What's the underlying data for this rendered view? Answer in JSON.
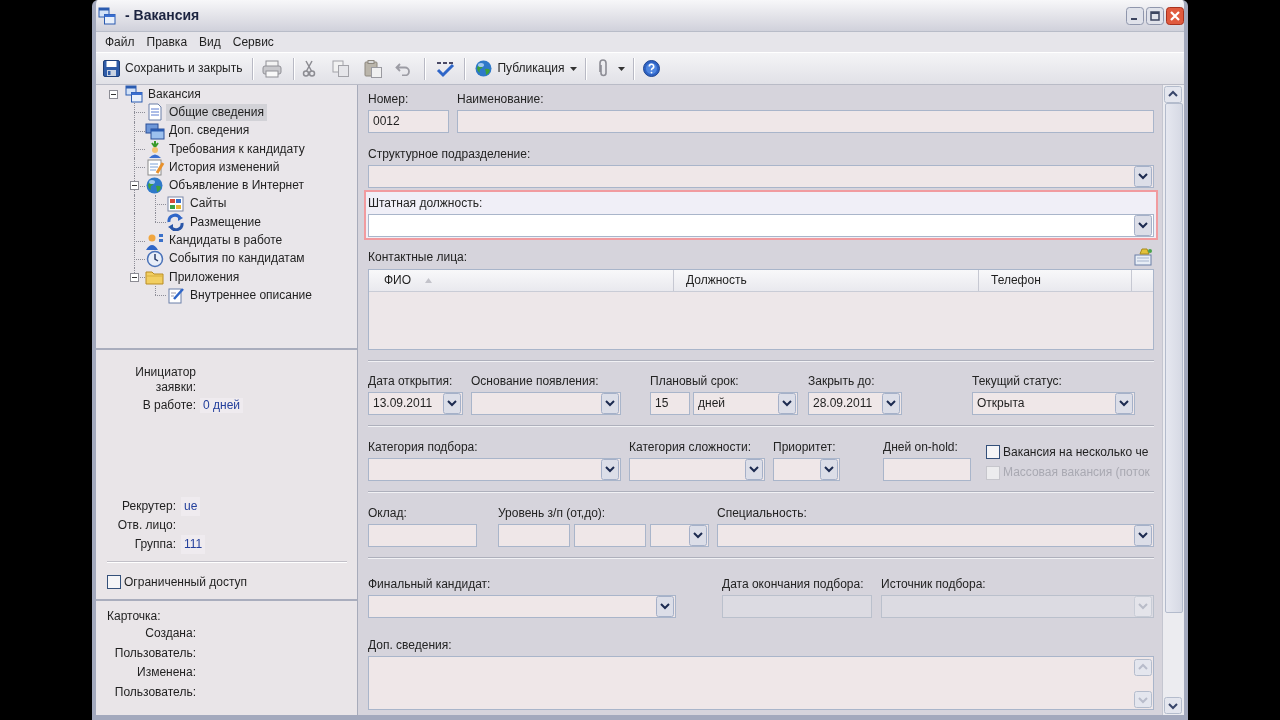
{
  "window": {
    "title": "- Вакансия"
  },
  "menu": [
    {
      "label": "Файл"
    },
    {
      "label": "Правка"
    },
    {
      "label": "Вид"
    },
    {
      "label": "Сервис"
    }
  ],
  "toolbar": {
    "save_button": {
      "label": "Сохранить и закрыть"
    },
    "print_button": {
      "disabled": true
    },
    "cut_button": {
      "disabled": true
    },
    "copy_button": {
      "disabled": true
    },
    "paste_button": {
      "disabled": true
    },
    "undo_button": {
      "disabled": true
    },
    "publish_button": {
      "label": "Публикация"
    }
  },
  "tree": [
    {
      "label": "Вакансия",
      "selected": false,
      "expanded": true,
      "children": [
        {
          "label": "Общие сведения",
          "selected": true
        },
        {
          "label": "Доп. сведения",
          "selected": false
        },
        {
          "label": "Требования к кандидату",
          "selected": false
        },
        {
          "label": "История изменений",
          "selected": false
        },
        {
          "label": "Объявление в Интернет",
          "selected": false,
          "expanded": true,
          "children": [
            {
              "label": "Сайты",
              "selected": false
            },
            {
              "label": "Размещение",
              "selected": false
            }
          ]
        },
        {
          "label": "Кандидаты в работе",
          "selected": false
        },
        {
          "label": "События по кандидатам",
          "selected": false
        },
        {
          "label": "Приложения",
          "selected": false,
          "expanded": true,
          "children": [
            {
              "label": "Внутреннее описание",
              "selected": false
            }
          ]
        }
      ]
    }
  ],
  "request_info": [
    {
      "label": "Инициатор заявки:"
    },
    {
      "label": "В работе:",
      "value": "0 дней"
    }
  ],
  "staff_info": [
    {
      "label": "Рекрутер:",
      "value": "ue"
    },
    {
      "label": "Отв. лицо:"
    },
    {
      "label": "Группа:",
      "value": "111"
    }
  ],
  "restricted_access": {
    "label": "Ограниченный доступ",
    "checked": false
  },
  "record_info": {
    "title": "Карточка:",
    "rows": [
      {
        "label": "Создана:"
      },
      {
        "label": "Пользователь:"
      },
      {
        "label": "Изменена:"
      },
      {
        "label": "Пользователь:"
      }
    ]
  },
  "form": {
    "number": {
      "label": "Номер:",
      "value": "0012"
    },
    "name": {
      "label": "Наименование:"
    },
    "department": {
      "label": "Структурное подразделение:"
    },
    "position": {
      "label": "Штатная должность:",
      "invalid": true
    },
    "contacts": {
      "label": "Контактные лица:",
      "columns": [
        {
          "label": "ФИО",
          "sorted": true
        },
        {
          "label": "Должность",
          "sorted": false
        },
        {
          "label": "Телефон",
          "sorted": false
        }
      ]
    },
    "open_date": {
      "label": "Дата открытия:",
      "value": "13.09.2011"
    },
    "reason": {
      "label": "Основание появления:"
    },
    "planned_term": {
      "label": "Плановый срок:",
      "value": "15",
      "unit": "дней"
    },
    "close_by": {
      "label": "Закрыть до:",
      "value": "28.09.2011"
    },
    "status": {
      "label": "Текущий статус:",
      "value": "Открыта"
    },
    "selection_category": {
      "label": "Категория подбора:"
    },
    "complexity": {
      "label": "Категория сложности:"
    },
    "priority": {
      "label": "Приоритет:"
    },
    "on_hold_days": {
      "label": "Дней on-hold:"
    },
    "multiple_hires": {
      "label": "Вакансия на несколько че",
      "checked": false,
      "disabled": false
    },
    "mass_hiring": {
      "label": "Массовая вакансия (поток",
      "checked": false,
      "disabled": true
    },
    "salary": {
      "label": "Оклад:"
    },
    "salary_range": {
      "label": "Уровень з/п (от,до):"
    },
    "speciality": {
      "label": "Специальность:"
    },
    "final_candidate": {
      "label": "Финальный кандидат:"
    },
    "end_date": {
      "label": "Дата окончания подбора:",
      "disabled": true
    },
    "source": {
      "label": "Источник подбора:",
      "disabled": true
    },
    "notes": {
      "label": "Доп. сведения:"
    }
  }
}
